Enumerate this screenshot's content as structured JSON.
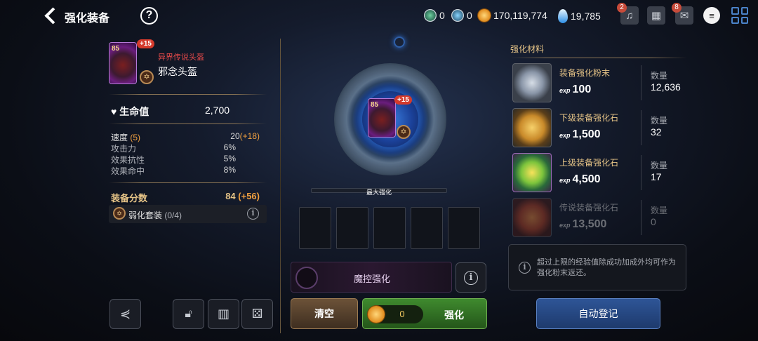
{
  "header": {
    "title": "强化装备",
    "help": "?"
  },
  "currencies": [
    {
      "icon": "green-token-icon",
      "value": "0"
    },
    {
      "icon": "blue-token-icon",
      "value": "0"
    },
    {
      "icon": "gold-coin-icon",
      "value": "170,119,774"
    },
    {
      "icon": "crystal-icon",
      "value": "19,785"
    }
  ],
  "top_icons": [
    {
      "icon": "bell-icon",
      "badge": "2"
    },
    {
      "icon": "castle-icon",
      "badge": ""
    },
    {
      "icon": "mail-icon",
      "badge": "8"
    },
    {
      "icon": "chat-icon",
      "badge": ""
    },
    {
      "icon": "grid-menu-icon",
      "badge": ""
    }
  ],
  "item": {
    "level": "85",
    "plus": "+15",
    "type": "异界传说头盔",
    "name": "邪念头盔"
  },
  "main_stat": {
    "label": "生命值",
    "value": "2,700"
  },
  "stats": [
    {
      "label": "速度",
      "extra": "(5)",
      "value": "20",
      "bonus": "(+18)"
    },
    {
      "label": "攻击力",
      "extra": "",
      "value": "6%",
      "bonus": ""
    },
    {
      "label": "效果抗性",
      "extra": "",
      "value": "5%",
      "bonus": ""
    },
    {
      "label": "效果命中",
      "extra": "",
      "value": "8%",
      "bonus": ""
    }
  ],
  "score": {
    "label": "装备分数",
    "value": "84",
    "bonus": "(+56)"
  },
  "set": {
    "label": "弱化套装",
    "count": "(0/4)"
  },
  "center": {
    "level": "85",
    "plus": "+15",
    "max_label": "最大强化",
    "magic_label": "魔控强化",
    "clear_label": "清空",
    "cost": "0",
    "enhance_label": "强化"
  },
  "materials_title": "强化材料",
  "qty_label": "数量",
  "exp_tag": "exp",
  "materials": [
    {
      "name": "装备强化粉末",
      "exp": "100",
      "qty": "12,636"
    },
    {
      "name": "下级装备强化石",
      "exp": "1,500",
      "qty": "32"
    },
    {
      "name": "上级装备强化石",
      "exp": "4,500",
      "qty": "17"
    },
    {
      "name": "传说装备强化石",
      "exp": "13,500",
      "qty": "0"
    }
  ],
  "notice": "超过上限的经验值除成功加成外均可作为强化粉末返还。",
  "auto_register": "自动登记",
  "colors": {
    "accent_orange": "#f0a040",
    "enhance_green": "#3f8a2e",
    "auto_blue": "#2a4a86"
  }
}
